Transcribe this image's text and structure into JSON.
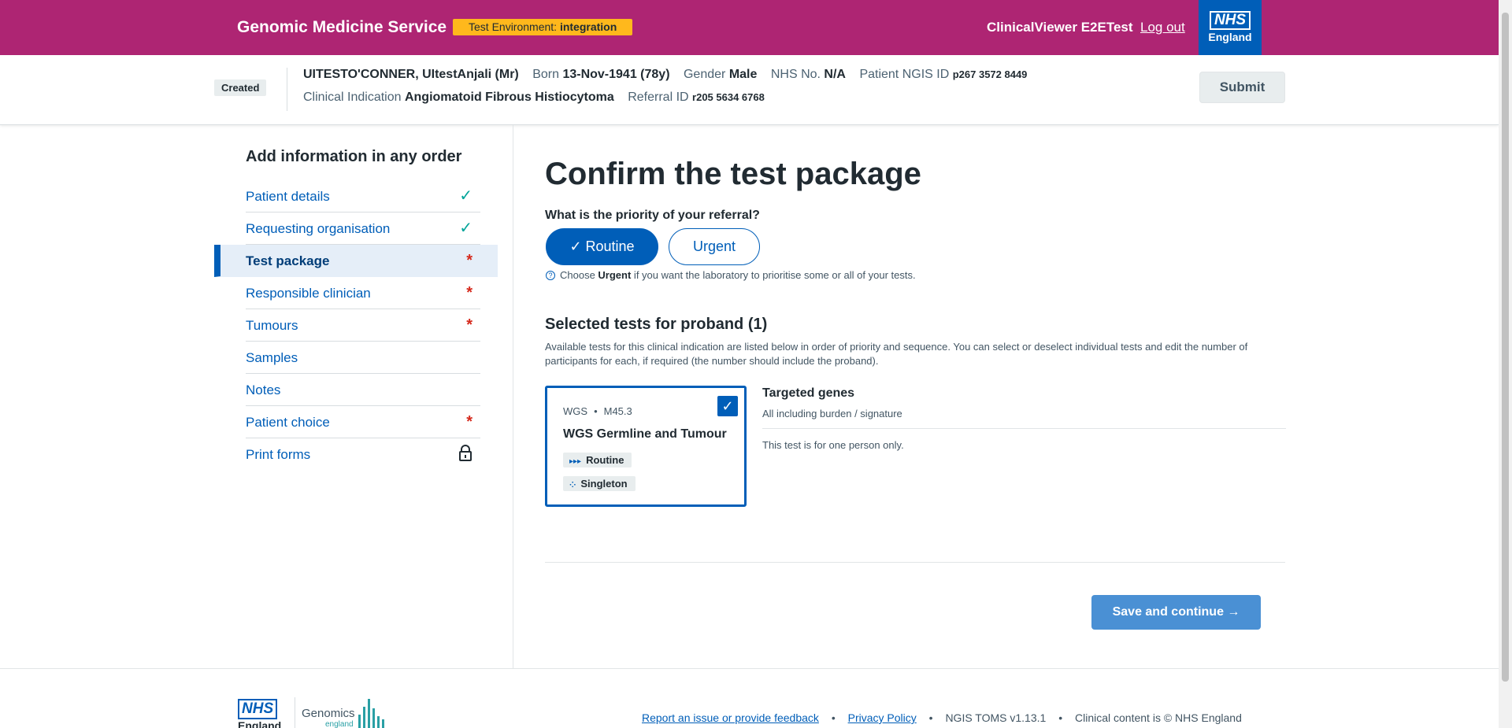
{
  "header": {
    "brand": "Genomic Medicine Service",
    "env_label": "Test Environment: ",
    "env_value": "integration",
    "user": "ClinicalViewer E2ETest",
    "logout": "Log out",
    "logo_nhs": "NHS",
    "logo_region": "England"
  },
  "banner": {
    "status": "Created",
    "patient_name": "UITESTO'CONNER, UItestAnjali (Mr)",
    "born_label": "Born",
    "born_value": "13-Nov-1941 (78y)",
    "gender_label": "Gender",
    "gender_value": "Male",
    "nhs_label": "NHS No.",
    "nhs_value": "N/A",
    "ngis_label": "Patient NGIS ID",
    "ngis_value": "p267 3572 8449",
    "ci_label": "Clinical Indication",
    "ci_value": "Angiomatoid Fibrous Histiocytoma",
    "ref_label": "Referral ID",
    "ref_value": "r205 5634 6768",
    "submit": "Submit"
  },
  "nav": {
    "title": "Add information in any order",
    "items": [
      {
        "label": "Patient details",
        "mark": "✓"
      },
      {
        "label": "Requesting organisation",
        "mark": "✓"
      },
      {
        "label": "Test package",
        "mark": "*"
      },
      {
        "label": "Responsible clinician",
        "mark": "*"
      },
      {
        "label": "Tumours",
        "mark": "*"
      },
      {
        "label": "Samples",
        "mark": ""
      },
      {
        "label": "Notes",
        "mark": ""
      },
      {
        "label": "Patient choice",
        "mark": "*"
      },
      {
        "label": "Print forms",
        "mark": "lock-icon"
      }
    ]
  },
  "main": {
    "title": "Confirm the test package",
    "priority_question": "What is the priority of your referral?",
    "routine_label": "✓ Routine",
    "urgent_label": "Urgent",
    "hint_pre": "Choose ",
    "hint_bold": "Urgent",
    "hint_post": " if you want the laboratory to prioritise some or all of your tests.",
    "selected_title": "Selected tests for proband (1)",
    "selected_desc": "Available tests for this clinical indication are listed below in order of priority and sequence. You can select or deselect individual tests and edit the number of participants for each, if required (the number should include the proband).",
    "test": {
      "type": "WGS",
      "code": "M45.3",
      "name": "WGS Germline and Tumour",
      "priority_tag": "Routine",
      "participants_tag": "Singleton",
      "selected": true
    },
    "targeted_title": "Targeted genes",
    "targeted_sub": "All including burden / signature",
    "targeted_note": "This test is for one person only.",
    "save_label": "Save and continue →"
  },
  "footer": {
    "logo_nhs": "NHS",
    "logo_region": "England",
    "genomics": "Genomics",
    "genomics_sub": "england",
    "links": [
      "Report an issue or provide feedback",
      "Privacy Policy"
    ],
    "version": "NGIS TOMS v1.13.1",
    "copyright": "Clinical content is © NHS England"
  },
  "colors": {
    "header": "#ae2573",
    "primary": "#005eb8",
    "env_badge": "#ffb81c",
    "tick": "#00a499",
    "required": "#d5281b"
  }
}
